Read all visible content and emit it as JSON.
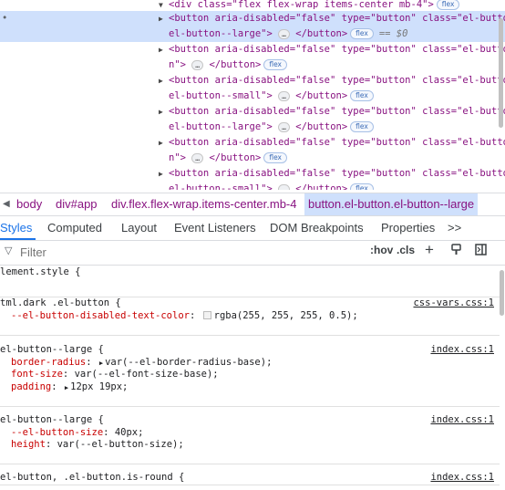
{
  "dom_tree": {
    "lines": [
      {
        "pre": "<div class=\"flex flex-wrap items-center mb-4\">",
        "badge": "flex"
      },
      {
        "pre": "<button aria-disabled=\"false\" type=\"button\" class=\"el-button",
        "selected": true
      },
      {
        "pre": "el-button--large\">",
        "ellipsis": "…",
        "post": "</button>",
        "badge": "flex",
        "dollar": "== $0",
        "selected": true
      },
      {
        "pre": "<button aria-disabled=\"false\" type=\"button\" class=\"el-butto"
      },
      {
        "pre": "n\">",
        "ellipsis": "…",
        "post": "</button>",
        "badge": "flex"
      },
      {
        "pre": "<button aria-disabled=\"false\" type=\"button\" class=\"el-button"
      },
      {
        "pre": "el-button--small\">",
        "ellipsis": "…",
        "post": "</button>",
        "badge": "flex"
      },
      {
        "pre": "<button aria-disabled=\"false\" type=\"button\" class=\"el-button"
      },
      {
        "pre": "el-button--large\">",
        "ellipsis": "…",
        "post": "</button>",
        "badge": "flex"
      },
      {
        "pre": "<button aria-disabled=\"false\" type=\"button\" class=\"el-butto"
      },
      {
        "pre": "n\">",
        "ellipsis": "…",
        "post": "</button>",
        "badge": "flex"
      },
      {
        "pre": "<button aria-disabled=\"false\" type=\"button\" class=\"el-button"
      },
      {
        "pre": "el-button--small\">",
        "ellipsis": "…",
        "post": "</button>",
        "badge": "flex"
      }
    ]
  },
  "breadcrumb": {
    "items": [
      "body",
      "div#app",
      "div.flex.flex-wrap.items-center.mb-4",
      "button.el-button.el-button--large"
    ]
  },
  "tabs": [
    "Styles",
    "Computed",
    "Layout",
    "Event Listeners",
    "DOM Breakpoints",
    "Properties",
    ">>"
  ],
  "filter": {
    "placeholder": "Filter",
    "hov": ":hov",
    "cls": ".cls",
    "plus": "+"
  },
  "styles": {
    "element_style": "lement.style {",
    "rules": [
      {
        "selector": "tml.dark .el-button {",
        "source": "css-vars.css:1",
        "props": [
          {
            "name": "--el-button-disabled-text-color",
            "value": "rgba(255, 255, 255, 0.5);",
            "swatch": true
          }
        ]
      },
      {
        "selector": "el-button--large {",
        "source": "index.css:1",
        "props": [
          {
            "name": "border-radius",
            "value": "var(--el-border-radius-base);",
            "expander": true
          },
          {
            "name": "font-size",
            "value": "var(--el-font-size-base);"
          },
          {
            "name": "padding",
            "value": "12px 19px;",
            "expander": true
          }
        ]
      },
      {
        "selector": "el-button--large {",
        "source": "index.css:1",
        "props": [
          {
            "name": "--el-button-size",
            "value": "40px;"
          },
          {
            "name": "height",
            "value": "var(--el-button-size);"
          }
        ]
      },
      {
        "selector": "el-button, .el-button.is-round {",
        "source": "index.css:1",
        "props": []
      }
    ]
  },
  "colors": {
    "selected_bg": "#cfe0fc",
    "accent": "#1a73e8",
    "tag": "#881280",
    "prop": "#c80000"
  }
}
